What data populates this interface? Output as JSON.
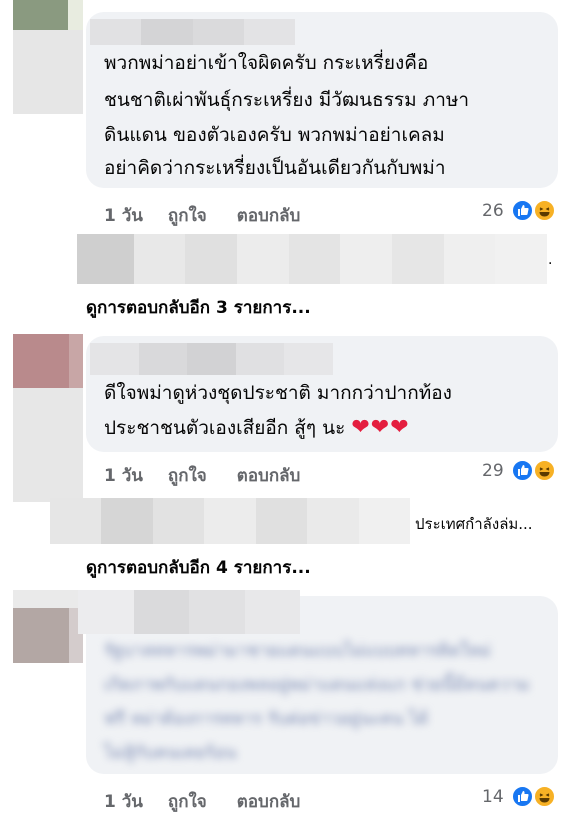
{
  "comments": [
    {
      "lines": [
        "พวกพม่าอย่าเข้าใจผิดครับ กระเหรี่ยงคือ",
        "ชนชาติเผ่าพันธุ์กระเหรี่ยง มีวัฒนธรรม ภาษา",
        "ดินแดน ของตัวเองครับ พวกพม่าอย่าเคลม",
        "อย่าคิดว่ากระเหรี่ยงเป็นอันเดียวกันกับพม่า"
      ],
      "time": "1 วัน",
      "like_label": "ถูกใจ",
      "reply_label": "ตอบกลับ",
      "reaction_count": "26",
      "reply_preview": ".",
      "more_replies": "ดูการตอบกลับอีก 3 รายการ..."
    },
    {
      "lines": [
        "ดีใจพม่าดูห่วงชุดประชาติ มากกว่าปากท้อง",
        "ประชาชนตัวเองเสียอีก สู้ๆ นะ"
      ],
      "hearts": "❤❤❤",
      "time": "1 วัน",
      "like_label": "ถูกใจ",
      "reply_label": "ตอบกลับ",
      "reaction_count": "29",
      "reply_preview": "ประเทศกำลังล่ม...",
      "more_replies": "ดูการตอบกลับอีก 4 รายการ..."
    },
    {
      "blurred_lines": [
        "รัฐบาลทหารพม่ามาชายแดนแบบไม่แบบทหารคิดใหม่",
        "เกิดภาพกับแดนกองพลอยู่พม่าแดนแห่งแก ช่วยนี้มีคนความ",
        "ฟรี หม่าต้องการทหาร รับต่อข่าวอยู่นะคน ได้",
        "ไม่สู้กับคนเคยร้อน"
      ],
      "time": "1 วัน",
      "like_label": "ถูกใจ",
      "reply_label": "ตอบกลับ",
      "reaction_count": "14"
    }
  ],
  "icons": {
    "like": "like-reaction-icon",
    "haha": "haha-reaction-icon"
  },
  "colors": {
    "bubble": "#f0f2f5",
    "meta": "#65676b",
    "like_blue": "#1877f2",
    "haha_yellow": "#f7b125",
    "heart_red": "#e41e3f"
  }
}
